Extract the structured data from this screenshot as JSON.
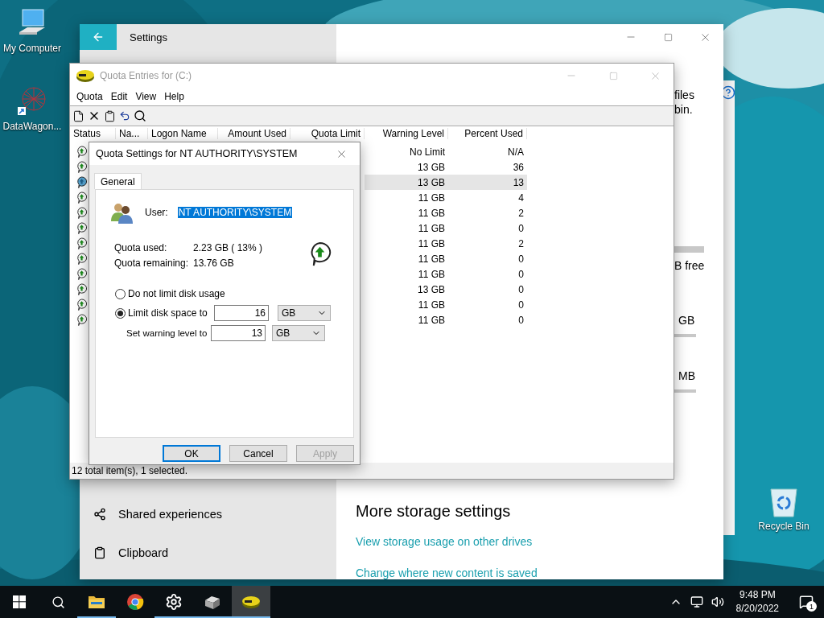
{
  "desktop_icons": [
    {
      "kind": "computer",
      "label": "My Computer"
    },
    {
      "kind": "app",
      "label": "DataWagon..."
    },
    {
      "kind": "recycle",
      "label": "Recycle Bin"
    }
  ],
  "settings": {
    "title": "Settings",
    "nav_items": [
      {
        "kind": "shared",
        "label": "Shared experiences"
      },
      {
        "kind": "clipboard",
        "label": "Clipboard"
      }
    ],
    "fragments": [
      "files",
      "bin.",
      "B free",
      "GB",
      "MB"
    ],
    "section_title": "More storage settings",
    "links": [
      "View storage usage on other drives",
      "Change where new content is saved"
    ]
  },
  "quota_window": {
    "title": "Quota Entries for  (C:)",
    "menu": [
      "Quota",
      "Edit",
      "View",
      "Help"
    ],
    "columns": [
      "Status",
      "Na...",
      "Logon Name",
      "Amount Used",
      "Quota Limit",
      "Warning Level",
      "Percent Used"
    ],
    "rows": [
      {
        "selected": false,
        "warning_level": "No Limit",
        "percent_used": "N/A"
      },
      {
        "selected": false,
        "warning_level": "13 GB",
        "percent_used": "36"
      },
      {
        "selected": true,
        "warning_level": "13 GB",
        "percent_used": "13"
      },
      {
        "selected": false,
        "warning_level": "11 GB",
        "percent_used": "4"
      },
      {
        "selected": false,
        "warning_level": "11 GB",
        "percent_used": "2"
      },
      {
        "selected": false,
        "warning_level": "11 GB",
        "percent_used": "0"
      },
      {
        "selected": false,
        "warning_level": "11 GB",
        "percent_used": "2"
      },
      {
        "selected": false,
        "warning_level": "11 GB",
        "percent_used": "0"
      },
      {
        "selected": false,
        "warning_level": "11 GB",
        "percent_used": "0"
      },
      {
        "selected": false,
        "warning_level": "13 GB",
        "percent_used": "0"
      },
      {
        "selected": false,
        "warning_level": "11 GB",
        "percent_used": "0"
      },
      {
        "selected": false,
        "warning_level": "11 GB",
        "percent_used": "0"
      }
    ],
    "status_bar": "12 total item(s), 1 selected."
  },
  "dialog": {
    "title": "Quota Settings for NT AUTHORITY\\SYSTEM",
    "tabs": [
      {
        "label": "General",
        "selected": true
      }
    ],
    "user_label": "User:",
    "user_value": "NT AUTHORITY\\SYSTEM",
    "stats": [
      {
        "label": "Quota used:",
        "value": "2.23 GB ( 13% )"
      },
      {
        "label": "Quota remaining:",
        "value": "13.76 GB"
      }
    ],
    "options": [
      {
        "label": "Do not limit disk usage",
        "selected": false
      },
      {
        "label": "Limit disk space to",
        "selected": true
      }
    ],
    "limit": {
      "value": "16",
      "unit": "GB"
    },
    "warning": {
      "label": "Set warning level to",
      "value": "13",
      "unit": "GB"
    },
    "buttons": [
      {
        "label": "OK",
        "default": true,
        "disabled": false
      },
      {
        "label": "Cancel",
        "default": false,
        "disabled": false
      },
      {
        "label": "Apply",
        "default": false,
        "disabled": true
      }
    ]
  },
  "taskbar": {
    "apps": [
      {
        "kind": "folder",
        "running": true,
        "selected": false
      },
      {
        "kind": "browser",
        "running": false,
        "selected": false
      },
      {
        "kind": "settings",
        "running": true,
        "selected": false
      },
      {
        "kind": "drive",
        "running": true,
        "selected": false
      },
      {
        "kind": "quota",
        "running": true,
        "selected": true
      }
    ],
    "time": "9:48 PM",
    "date": "8/20/2022",
    "notifications": "1"
  }
}
